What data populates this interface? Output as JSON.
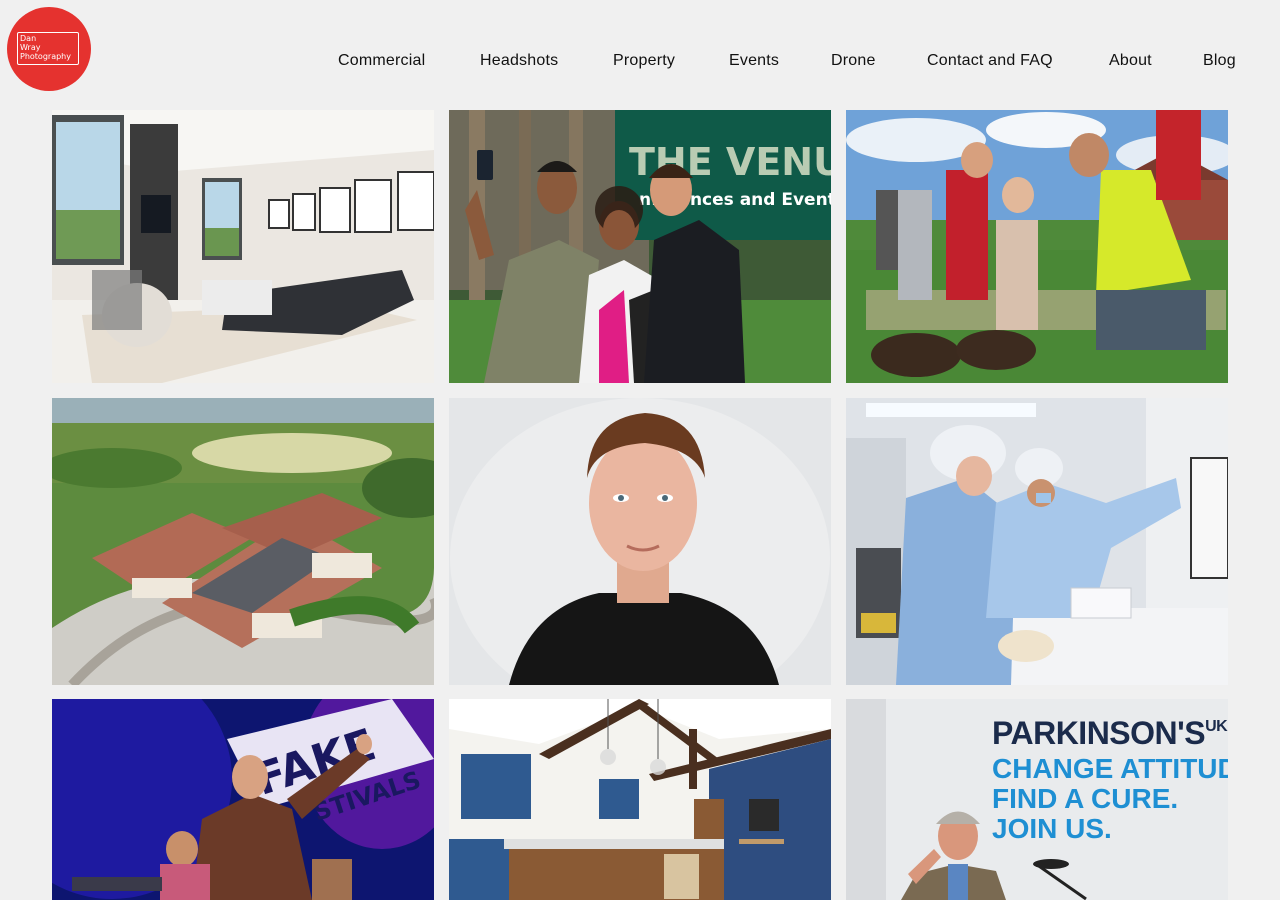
{
  "site": {
    "logo": {
      "line1": "Dan",
      "line2": "Wray",
      "line3": "Photography",
      "color": "#e5322f"
    }
  },
  "nav": {
    "items": [
      {
        "label": "Commercial"
      },
      {
        "label": "Headshots"
      },
      {
        "label": "Property"
      },
      {
        "label": "Events"
      },
      {
        "label": "Drone"
      },
      {
        "label": "Contact and FAQ"
      },
      {
        "label": "About"
      },
      {
        "label": "Blog"
      }
    ]
  },
  "gallery": {
    "tiles": [
      {
        "subject": "living-room-interior"
      },
      {
        "subject": "selfie-group",
        "sign_line1": "THE VENUE",
        "sign_line2": "nferences and Event"
      },
      {
        "subject": "family-planting-tree"
      },
      {
        "subject": "aerial-housing-development"
      },
      {
        "subject": "young-man-headshot"
      },
      {
        "subject": "laboratory-scientists"
      },
      {
        "subject": "festival-singer",
        "banner": "FAKE",
        "banner_sub": "STIVALS"
      },
      {
        "subject": "kitchen-interior"
      },
      {
        "subject": "parkinsons-speaker",
        "wall_line1": "PARKINSON'S",
        "wall_sup": "UK",
        "wall_line2": "CHANGE ATTITUDE",
        "wall_line3": "FIND A CURE.",
        "wall_line4": "JOIN US."
      }
    ]
  }
}
